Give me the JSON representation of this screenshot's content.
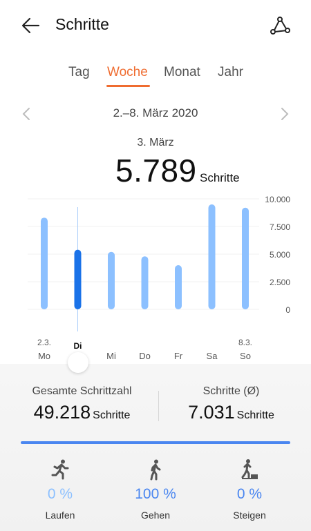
{
  "header": {
    "title": "Schritte",
    "back_icon": "arrow-left-icon",
    "route_icon": "route-icon"
  },
  "tabs": [
    {
      "label": "Tag",
      "active": false
    },
    {
      "label": "Woche",
      "active": true
    },
    {
      "label": "Monat",
      "active": false
    },
    {
      "label": "Jahr",
      "active": false
    }
  ],
  "date_nav": {
    "range": "2.–8. März 2020"
  },
  "selection": {
    "date": "3. März",
    "value": "5.789",
    "unit": "Schritte"
  },
  "colors": {
    "accent": "#ef6c30",
    "bar": "#8cc0ff",
    "bar_selected": "#1a72e8",
    "blue": "#4a86f0"
  },
  "chart_data": {
    "type": "bar",
    "categories": [
      "Mo",
      "Di",
      "Mi",
      "Do",
      "Fr",
      "Sa",
      "So"
    ],
    "date_labels": [
      "2.3.",
      "",
      "",
      "",
      "",
      "",
      "8.3."
    ],
    "values": [
      8300,
      5400,
      5200,
      4800,
      4000,
      9500,
      9200
    ],
    "selected_index": 1,
    "ylim": [
      0,
      10000
    ],
    "yticks": [
      "10.000",
      "7.500",
      "5.000",
      "2.500",
      "0"
    ],
    "ytick_values": [
      10000,
      7500,
      5000,
      2500,
      0
    ],
    "grid": true
  },
  "summary": {
    "total_label": "Gesamte Schrittzahl",
    "total_value": "49.218",
    "total_unit": "Schritte",
    "avg_label": "Schritte (Ø)",
    "avg_value": "7.031",
    "avg_unit": "Schritte"
  },
  "activities": [
    {
      "icon": "running-icon",
      "pct": "0 %",
      "label": "Laufen"
    },
    {
      "icon": "walking-icon",
      "pct": "100 %",
      "label": "Gehen"
    },
    {
      "icon": "climbing-icon",
      "pct": "0 %",
      "label": "Steigen"
    }
  ]
}
